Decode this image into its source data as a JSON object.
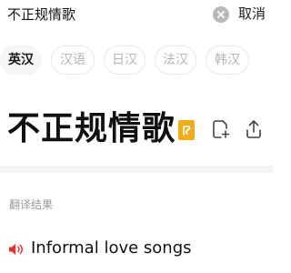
{
  "search": {
    "query": "不正规情歌",
    "cancel_label": "取消"
  },
  "languages": [
    {
      "label": "英汉",
      "active": true
    },
    {
      "label": "汉语",
      "active": false
    },
    {
      "label": "日汉",
      "active": false
    },
    {
      "label": "法汉",
      "active": false
    },
    {
      "label": "韩汉",
      "active": false
    }
  ],
  "entry": {
    "word": "不正规情歌"
  },
  "result": {
    "section_title": "翻译结果",
    "translation": "Informal love songs"
  },
  "icons": {
    "clear": "clear-icon",
    "wordbook": "wordbook-icon",
    "add_note": "add-note-icon",
    "share": "share-icon",
    "speaker": "speaker-icon"
  },
  "colors": {
    "accent_orange": "#f0ad1e",
    "speaker_red": "#e0342f",
    "muted_text": "#9a9a9a"
  }
}
